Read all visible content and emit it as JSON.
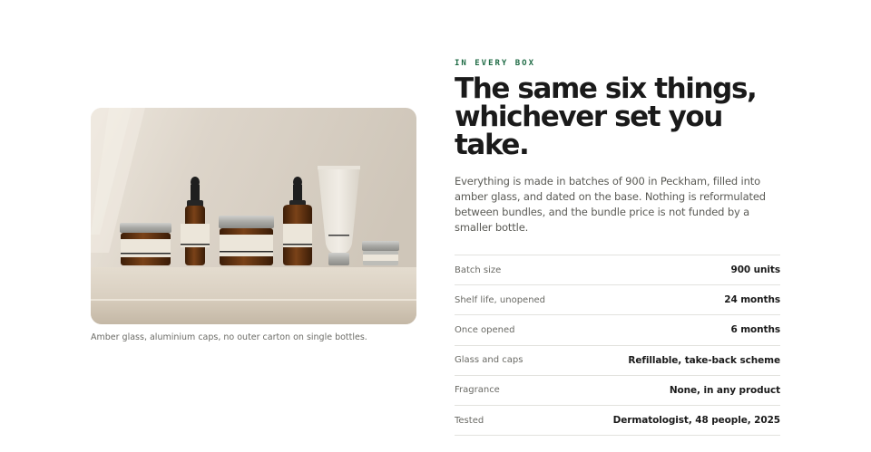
{
  "image": {
    "alt": "Amber glass bottles and jars with aluminium caps on a stone shelf",
    "caption": "Amber glass, aluminium caps, no outer carton on single bottles."
  },
  "section": {
    "eyebrow": "IN EVERY BOX",
    "headline_line1": "The same six things,",
    "headline_line2": "whichever set you take.",
    "body": "Everything is made in batches of 900 in Peckham, filled into amber glass, and dated on the base. Nothing is reformulated between bundles, and the bundle price is not funded by a smaller bottle."
  },
  "specs": [
    {
      "label": "Batch size",
      "value": "900 units"
    },
    {
      "label": "Shelf life, unopened",
      "value": "24 months"
    },
    {
      "label": "Once opened",
      "value": "6 months"
    },
    {
      "label": "Glass and caps",
      "value": "Refillable, take-back scheme"
    },
    {
      "label": "Fragrance",
      "value": "None, in any product"
    },
    {
      "label": "Tested",
      "value": "Dermatologist, 48 people, 2025"
    }
  ],
  "colors": {
    "accent": "#1f6b45",
    "amber_glass": "#5a2f10",
    "label_cream": "#ece6da",
    "shelf": "#d9cfc1",
    "wall": "#d8d1c6"
  }
}
